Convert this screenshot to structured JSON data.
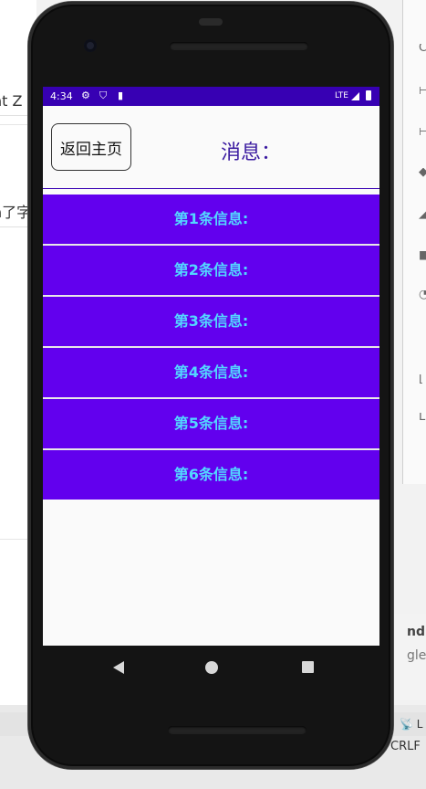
{
  "background": {
    "left_snippets": [
      "nt Z",
      "n了字"
    ],
    "right_panel": [
      "nd p",
      "gle"
    ],
    "status_right": "📡 L",
    "line_ending": "CRLF"
  },
  "phone": {
    "status_bar": {
      "time": "4:34",
      "network": "LTE",
      "icons": [
        "gear-icon",
        "shield-icon",
        "sd-card-icon",
        "signal-icon",
        "battery-icon"
      ]
    },
    "app": {
      "back_button_label": "返回主页",
      "title": "消息：",
      "messages": [
        "第1条信息:",
        "第2条信息:",
        "第3条信息:",
        "第4条信息:",
        "第5条信息:",
        "第6条信息:"
      ],
      "colors": {
        "status_bar": "#3700b3",
        "item_bg": "#6200ee",
        "item_text": "#53d7ff",
        "title_text": "#3a1aa0"
      }
    },
    "nav_bar": [
      "back-icon",
      "home-icon",
      "recents-icon"
    ]
  }
}
